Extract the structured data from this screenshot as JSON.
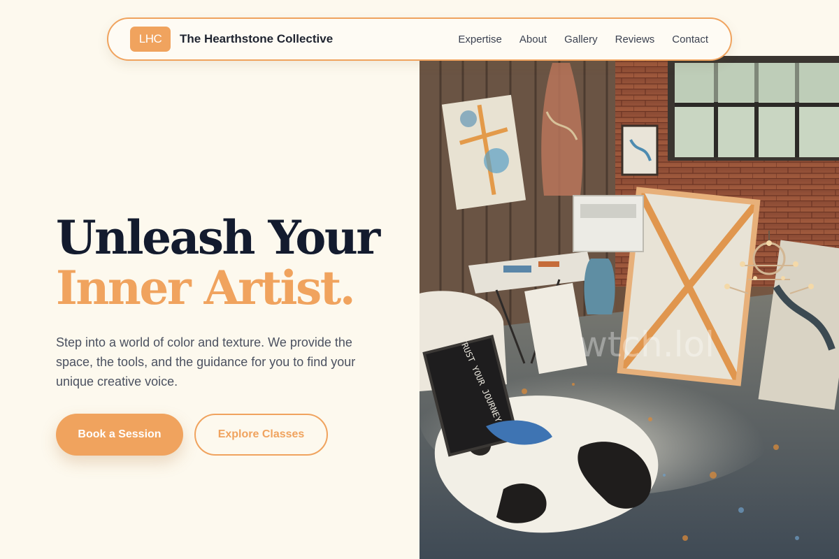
{
  "nav": {
    "logo_text": "LHC",
    "brand_name": "The Hearthstone Collective",
    "links": [
      "Expertise",
      "About",
      "Gallery",
      "Reviews",
      "Contact"
    ]
  },
  "hero": {
    "title_line1": "Unleash Your",
    "title_line2": "Inner Artist.",
    "description": "Step into a world of color and texture. We provide the space, the tools, and the guidance for you to find your unique creative voice.",
    "primary_button": "Book a Session",
    "secondary_button": "Explore Classes",
    "image": {
      "subject": "art studio with canvases, brick wall, chandelier and paint-splattered floor",
      "canvas_text": "TRUST YOUR JOURNEY",
      "watermark": "wtch.lol"
    }
  },
  "colors": {
    "background": "#fdf9ee",
    "accent": "#f0a35e",
    "heading": "#131b2e",
    "body_text": "#4b5160"
  }
}
